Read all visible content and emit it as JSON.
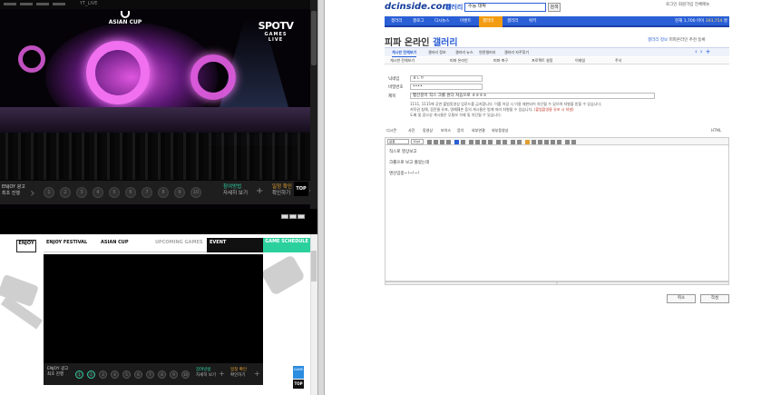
{
  "left": {
    "video1": {
      "topbar_nick": "YT_LIVE",
      "broadcast_logo": "ASIAN CUP",
      "channel": {
        "main": "SPOTV",
        "sub": "GAMES",
        "live": "LIVE"
      },
      "ad": [
        "ENJOY 광고",
        "최초 진행"
      ],
      "numbers": [
        "1",
        "2",
        "3",
        "4",
        "5",
        "6",
        "7",
        "8",
        "9",
        "10"
      ],
      "promo1": [
        "참여방법",
        "자세히 보기"
      ],
      "promo2": [
        "일정 확인",
        "확인하기"
      ],
      "top_label": "TOP"
    },
    "site2": {
      "logo": "ENJOY",
      "tabs": [
        "ENJOY FESTIVAL",
        "ASIAN CUP",
        "UPCOMING GAMES",
        "EVENT"
      ],
      "game_schedule": "GAME SCHEDULE",
      "ad": [
        "ENJOY 광고",
        "최초 진행"
      ],
      "numbers": [
        "1",
        "2",
        "3",
        "4",
        "5",
        "6",
        "7",
        "8",
        "9",
        "10"
      ],
      "promo1": [
        "참여방법",
        "자세히 보기"
      ],
      "promo2": [
        "일정 확인",
        "확인하기"
      ],
      "side_blue": "GAME",
      "top_label": "TOP"
    }
  },
  "right": {
    "logo": "dcinside.com",
    "logo_gallery": "갤러리",
    "search_value": "수능 대박",
    "search_button": "검색",
    "top_links": "로그인  회원가입  전체메뉴",
    "nav": [
      "갤러리",
      "갤로그",
      "디시뉴스",
      "이벤트",
      "갤러리",
      "갤러리",
      "위키"
    ],
    "nav_active_index": 4,
    "nav_info_prefix": "현재 1,700 마이",
    "nav_info_hi": "393,754",
    "nav_info_suffix": "명 접속",
    "gallery_title": "피파 온라인",
    "gallery_title_hl": "갤러리",
    "gallery_links_b": "갤러리 정보",
    "gallery_links": "피파온라인 추천 등록",
    "subtabs": [
      "게시판 전체보기",
      "갤러리 정보",
      "갤러리 뉴스",
      "연관갤러리",
      "갤러리 자주찾기"
    ],
    "cat_items": [
      "게시판 전체보기",
      "피파 온라인",
      "피파 축구",
      "프로젝트 설정",
      "이재일",
      "주식"
    ],
    "form": {
      "nick_label": "닉네임",
      "nick_value": "ㅎㄴㅇ",
      "pw_label": "비밀번호",
      "pw_value": "••••",
      "title_label": "제목",
      "title_value": "펩신붕이 직스 크롤 원다 처음으로 ㅎㅎㅎㅎ"
    },
    "notice": [
      "1111, 1115에 공연 불법동영상 업로드를 금지합니다. 이를 어길 시 이용 제한되어 차단될 수 있으며 처벌을 받을 수 있습니다.",
      "저작권 침해, 음란물 유포, 명예훼손 등의 게시물은 법에 따라 처벌될 수 있습니다.",
      "도배 및 광고성 게시물은 무통보 삭제 및 차단될 수 있습니다."
    ],
    "notice_red": "(불법촬영물 유포 시 처벌)",
    "editor_tabs": [
      "디시콘",
      "사진",
      "동영상",
      "보이스",
      "음악",
      "외부연결",
      "외부동영상"
    ],
    "html_check": "HTML",
    "toolbar_font": "글꼴",
    "toolbar_size": "10pt",
    "content_lines": [
      "직스로 영상보고",
      "크롤으로 보고 졸았는데",
      "명신임중~!~!~!"
    ],
    "cancel": "취소",
    "submit": "작성"
  }
}
